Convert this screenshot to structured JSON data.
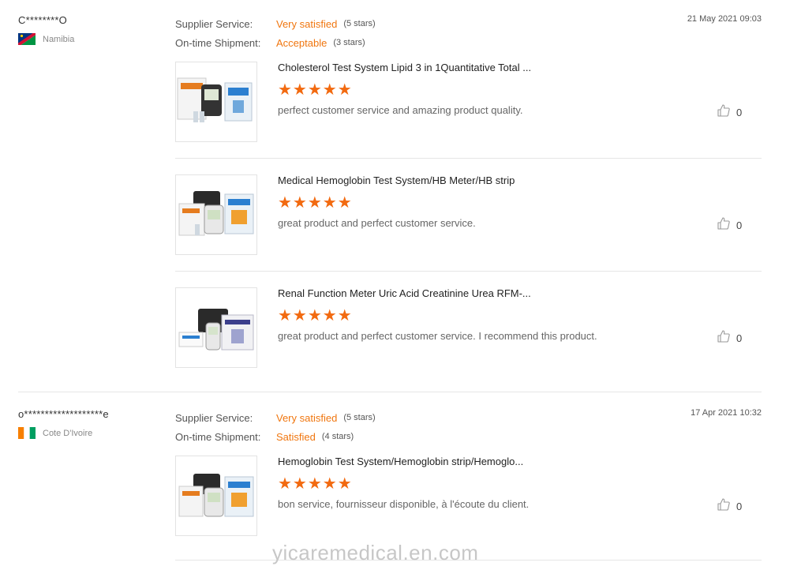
{
  "labels": {
    "supplier_service": "Supplier Service:",
    "ontime_shipment": "On-time Shipment:"
  },
  "reviews": [
    {
      "user": "C********O",
      "country": "Namibia",
      "date": "21 May 2021 09:03",
      "supplier_value": "Very satisfied",
      "supplier_stars": "(5 stars)",
      "shipment_value": "Acceptable",
      "shipment_stars": "(3 stars)",
      "products": [
        {
          "title": "Cholesterol Test System Lipid 3 in 1Quantitative Total ...",
          "rating": 5,
          "stars": "★★★★★",
          "comment": "perfect  customer service and amazing product  quality.",
          "likes": "0"
        },
        {
          "title": "Medical Hemoglobin Test System/HB Meter/HB strip",
          "rating": 5,
          "stars": "★★★★★",
          "comment": "great product and perfect  customer service.",
          "likes": "0"
        },
        {
          "title": "Renal Function Meter Uric Acid Creatinine Urea RFM-...",
          "rating": 5,
          "stars": "★★★★★",
          "comment": "great product and perfect  customer service. I recommend  this  product.",
          "likes": "0"
        }
      ]
    },
    {
      "user": "o*******************e",
      "country": "Cote D'Ivoire",
      "date": "17 Apr 2021 10:32",
      "supplier_value": "Very satisfied",
      "supplier_stars": "(5 stars)",
      "shipment_value": "Satisfied",
      "shipment_stars": "(4 stars)",
      "products": [
        {
          "title": "Hemoglobin Test System/Hemoglobin strip/Hemoglo...",
          "rating": 5,
          "stars": "★★★★★",
          "comment": "bon service, fournisseur disponible, à l'écoute du client.",
          "likes": "0"
        }
      ]
    }
  ],
  "watermark": "yicaremedical.en.com",
  "colors": {
    "accent": "#f0760f",
    "star": "#f26a10"
  },
  "icons": {
    "like": "thumbs-up-icon",
    "flag_1": "namibia-flag-icon",
    "flag_2": "cote-divoire-flag-icon"
  }
}
